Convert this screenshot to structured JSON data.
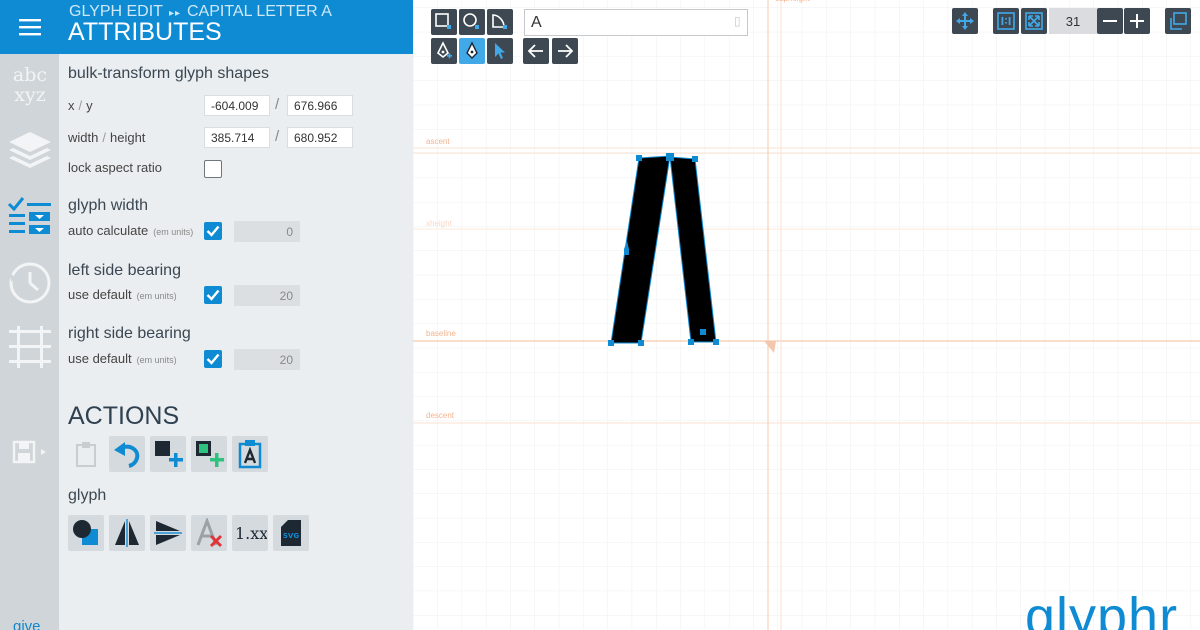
{
  "app": {
    "breadcrumb_mode": "GLYPH EDIT",
    "breadcrumb_sep": "▸▸",
    "breadcrumb_item": "CAPITAL LETTER A",
    "panel_title": "ATTRIBUTES",
    "logo_text": "glyphr",
    "give_text": "give"
  },
  "rail": {
    "items": [
      "hamburger-icon",
      "glyph-chooser-icon",
      "layers-icon",
      "attributes-icon",
      "history-icon",
      "guides-icon",
      "save-icon"
    ],
    "active": "attributes-icon"
  },
  "bulk": {
    "title": "bulk-transform glyph shapes",
    "xy_label_x": "x",
    "xy_label_y": "y",
    "x_value": "-604.009",
    "y_value": "676.966",
    "wh_label_w": "width",
    "wh_label_h": "height",
    "width_value": "385.714",
    "height_value": "680.952",
    "lock_label": "lock aspect ratio",
    "lock_checked": false,
    "separator": "/"
  },
  "glyph_width": {
    "title": "glyph width",
    "label": "auto calculate",
    "unit": "(em units)",
    "checked": true,
    "value": "0"
  },
  "lsb": {
    "title": "left side bearing",
    "label": "use default",
    "unit": "(em units)",
    "checked": true,
    "value": "20"
  },
  "rsb": {
    "title": "right side bearing",
    "label": "use default",
    "unit": "(em units)",
    "checked": true,
    "value": "20"
  },
  "actions": {
    "title": "ACTIONS",
    "row1": [
      "paste-icon",
      "undo-icon",
      "add-shape-icon",
      "add-component-icon",
      "glyph-linked-icon"
    ],
    "glyph_label": "glyph",
    "row2": [
      "combine-shapes-icon",
      "flip-horizontal-icon",
      "flip-vertical-icon",
      "clear-glyph-icon",
      "round-coordinates-icon",
      "export-svg-icon"
    ],
    "round_text": "1.xx",
    "svg_text": "SVG"
  },
  "canvas": {
    "glyph_value": "A",
    "zoom_value": "31",
    "guides": {
      "ascent": "ascent",
      "capheight": "capheight",
      "xheight": "xheight",
      "baseline": "baseline",
      "descent": "descent"
    },
    "colors": {
      "accent": "#0e8bd3",
      "tool_bg": "#3d4852",
      "tool_selected": "#42a9e8",
      "guide": "#f6c9ad",
      "grid": "#eef0f2"
    }
  }
}
